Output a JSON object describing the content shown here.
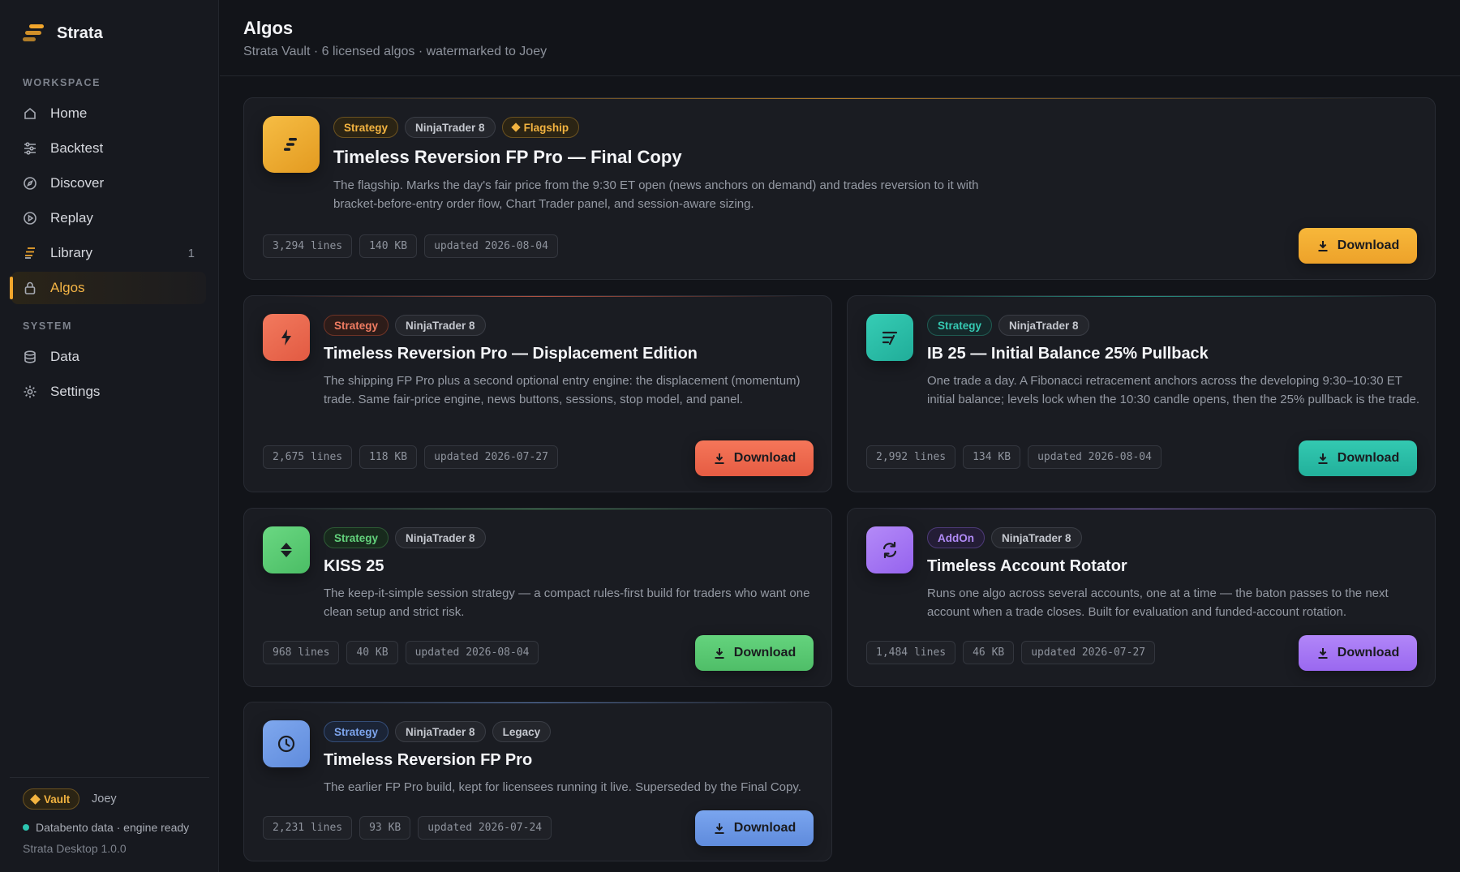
{
  "app": {
    "name": "Strata",
    "version": "Strata Desktop 1.0.0"
  },
  "sidebar": {
    "workspace_label": "WORKSPACE",
    "system_label": "SYSTEM",
    "items": [
      {
        "label": "Home",
        "icon": "home-icon"
      },
      {
        "label": "Backtest",
        "icon": "sliders-icon"
      },
      {
        "label": "Discover",
        "icon": "compass-icon"
      },
      {
        "label": "Replay",
        "icon": "play-circle-icon"
      },
      {
        "label": "Library",
        "icon": "layers-icon",
        "count": "1"
      },
      {
        "label": "Algos",
        "icon": "lock-icon",
        "active": true
      },
      {
        "label": "Data",
        "icon": "database-icon"
      },
      {
        "label": "Settings",
        "icon": "gear-icon"
      }
    ],
    "footer": {
      "vault_badge": "Vault",
      "user": "Joey",
      "status": "Databento data · engine ready"
    }
  },
  "header": {
    "title": "Algos",
    "subtitle": "Strata Vault · 6 licensed algos · watermarked to Joey"
  },
  "colors": {
    "orange": "#f2a62c",
    "red": "#ef6a4f",
    "teal": "#2ec4ad",
    "green": "#5fcf78",
    "purple": "#a878f5",
    "blue": "#6f9ce8"
  },
  "cards": [
    {
      "tags": [
        "Strategy",
        "NinjaTrader 8",
        "Flagship"
      ],
      "title": "Timeless Reversion FP Pro — Final Copy",
      "description": "The flagship. Marks the day's fair price from the 9:30 ET open (news anchors on demand) and trades reversion to it with bracket-before-entry order flow, Chart Trader panel, and session-aware sizing.",
      "meta": [
        "3,294 lines",
        "140 KB",
        "updated 2026-08-04"
      ],
      "button": "Download"
    },
    {
      "tags": [
        "Strategy",
        "NinjaTrader 8"
      ],
      "title": "Timeless Reversion Pro — Displacement Edition",
      "description": "The shipping FP Pro plus a second optional entry engine: the displacement (momentum) trade. Same fair-price engine, news buttons, sessions, stop model, and panel.",
      "meta": [
        "2,675 lines",
        "118 KB",
        "updated 2026-07-27"
      ],
      "button": "Download"
    },
    {
      "tags": [
        "Strategy",
        "NinjaTrader 8"
      ],
      "title": "IB 25 — Initial Balance 25% Pullback",
      "description": "One trade a day. A Fibonacci retracement anchors across the developing 9:30–10:30 ET initial balance; levels lock when the 10:30 candle opens, then the 25% pullback is the trade.",
      "meta": [
        "2,992 lines",
        "134 KB",
        "updated 2026-08-04"
      ],
      "button": "Download"
    },
    {
      "tags": [
        "Strategy",
        "NinjaTrader 8"
      ],
      "title": "KISS 25",
      "description": "The keep-it-simple session strategy — a compact rules-first build for traders who want one clean setup and strict risk.",
      "meta": [
        "968 lines",
        "40 KB",
        "updated 2026-08-04"
      ],
      "button": "Download"
    },
    {
      "tags": [
        "AddOn",
        "NinjaTrader 8"
      ],
      "title": "Timeless Account Rotator",
      "description": "Runs one algo across several accounts, one at a time — the baton passes to the next account when a trade closes. Built for evaluation and funded-account rotation.",
      "meta": [
        "1,484 lines",
        "46 KB",
        "updated 2026-07-27"
      ],
      "button": "Download"
    },
    {
      "tags": [
        "Strategy",
        "NinjaTrader 8",
        "Legacy"
      ],
      "title": "Timeless Reversion FP Pro",
      "description": "The earlier FP Pro build, kept for licensees running it live. Superseded by the Final Copy.",
      "meta": [
        "2,231 lines",
        "93 KB",
        "updated 2026-07-24"
      ],
      "button": "Download"
    }
  ]
}
